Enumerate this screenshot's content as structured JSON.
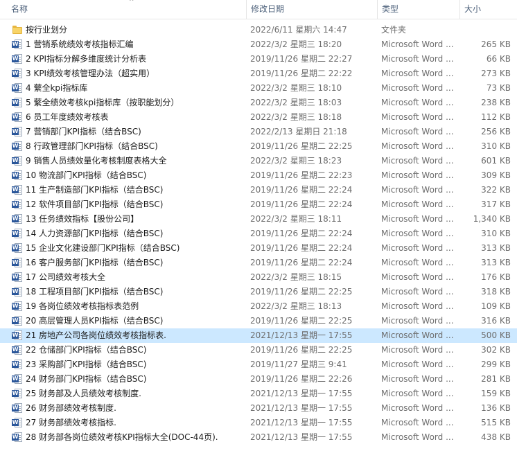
{
  "columns": {
    "name": "名称",
    "date": "修改日期",
    "type": "类型",
    "size": "大小"
  },
  "sort_indicator": "^",
  "word_badge_letter": "W",
  "rows": [
    {
      "kind": "folder",
      "name": "按行业划分",
      "date": "2022/6/11 星期六 14:47",
      "type": "文件夹",
      "size": ""
    },
    {
      "kind": "word",
      "name": "1 营销系统绩效考核指标汇编",
      "date": "2022/3/2 星期三 18:20",
      "type": "Microsoft Word ...",
      "size": "265 KB"
    },
    {
      "kind": "word",
      "name": "2 KPI指标分解多维度统计分析表",
      "date": "2019/11/26 星期二 22:27",
      "type": "Microsoft Word ...",
      "size": "66 KB"
    },
    {
      "kind": "word",
      "name": "3 KPI绩效考核管理办法（超实用）",
      "date": "2019/11/26 星期二 22:22",
      "type": "Microsoft Word ...",
      "size": "273 KB"
    },
    {
      "kind": "word",
      "name": "4 蘩全kpi指标库",
      "date": "2022/3/2 星期三 18:10",
      "type": "Microsoft Word ...",
      "size": "73 KB"
    },
    {
      "kind": "word",
      "name": "5 蘩全绩效考核kpi指标库（按职能划分）",
      "date": "2022/3/2 星期三 18:03",
      "type": "Microsoft Word ...",
      "size": "238 KB"
    },
    {
      "kind": "word",
      "name": "6 员工年度绩效考核表",
      "date": "2022/3/2 星期三 18:18",
      "type": "Microsoft Word ...",
      "size": "112 KB"
    },
    {
      "kind": "word",
      "name": "7 营销部门KPI指标（结合BSC)",
      "date": "2022/2/13 星期日 21:18",
      "type": "Microsoft Word ...",
      "size": "256 KB"
    },
    {
      "kind": "word",
      "name": "8 行政管理部门KPI指标（结合BSC)",
      "date": "2019/11/26 星期二 22:25",
      "type": "Microsoft Word ...",
      "size": "310 KB"
    },
    {
      "kind": "word",
      "name": "9 销售人员绩效量化考核制度表格大全",
      "date": "2022/3/2 星期三 18:23",
      "type": "Microsoft Word ...",
      "size": "601 KB"
    },
    {
      "kind": "word",
      "name": "10 物流部门KPI指标（结合BSC)",
      "date": "2019/11/26 星期二 22:23",
      "type": "Microsoft Word ...",
      "size": "309 KB"
    },
    {
      "kind": "word",
      "name": "11 生产制造部门KPI指标（结合BSC)",
      "date": "2019/11/26 星期二 22:24",
      "type": "Microsoft Word ...",
      "size": "322 KB"
    },
    {
      "kind": "word",
      "name": "12 软件项目部门KPI指标（结合BSC)",
      "date": "2019/11/26 星期二 22:24",
      "type": "Microsoft Word ...",
      "size": "317 KB"
    },
    {
      "kind": "word",
      "name": "13 任务绩效指标【股份公司】",
      "date": "2022/3/2 星期三 18:11",
      "type": "Microsoft Word ...",
      "size": "1,340 KB"
    },
    {
      "kind": "word",
      "name": "14 人力资源部门KPI指标（结合BSC)",
      "date": "2019/11/26 星期二 22:24",
      "type": "Microsoft Word ...",
      "size": "310 KB"
    },
    {
      "kind": "word",
      "name": "15 企业文化建设部门KPI指标（结合BSC)",
      "date": "2019/11/26 星期二 22:24",
      "type": "Microsoft Word ...",
      "size": "313 KB"
    },
    {
      "kind": "word",
      "name": "16 客户服务部门KPI指标（结合BSC)",
      "date": "2019/11/26 星期二 22:24",
      "type": "Microsoft Word ...",
      "size": "313 KB"
    },
    {
      "kind": "word",
      "name": "17 公司绩效考核大全",
      "date": "2022/3/2 星期三 18:15",
      "type": "Microsoft Word ...",
      "size": "176 KB"
    },
    {
      "kind": "word",
      "name": "18 工程项目部门KPI指标（结合BSC)",
      "date": "2019/11/26 星期二 22:25",
      "type": "Microsoft Word ...",
      "size": "318 KB"
    },
    {
      "kind": "word",
      "name": "19 各岗位绩效考核指标表范例",
      "date": "2022/3/2 星期三 18:13",
      "type": "Microsoft Word ...",
      "size": "109 KB"
    },
    {
      "kind": "word",
      "name": "20 高层管理人员KPI指标（结合BSC)",
      "date": "2019/11/26 星期二 22:25",
      "type": "Microsoft Word ...",
      "size": "316 KB"
    },
    {
      "kind": "word",
      "name": "21 房地产公司各岗位绩效考核指标表.",
      "date": "2021/12/13 星期一 17:55",
      "type": "Microsoft Word ...",
      "size": "500 KB",
      "selected": true
    },
    {
      "kind": "word",
      "name": "22 仓储部门KPI指标（结合BSC)",
      "date": "2019/11/26 星期二 22:25",
      "type": "Microsoft Word ...",
      "size": "302 KB"
    },
    {
      "kind": "word",
      "name": "23 采购部门KPI指标（结合BSC)",
      "date": "2019/11/27 星期三 9:41",
      "type": "Microsoft Word ...",
      "size": "299 KB"
    },
    {
      "kind": "word",
      "name": "24 财务部门KPI指标（结合BSC)",
      "date": "2019/11/26 星期二 22:26",
      "type": "Microsoft Word ...",
      "size": "281 KB"
    },
    {
      "kind": "word",
      "name": "25 财务部及人员绩效考核制度.",
      "date": "2021/12/13 星期一 17:55",
      "type": "Microsoft Word ...",
      "size": "159 KB"
    },
    {
      "kind": "word",
      "name": "26 财务部绩效考核制度.",
      "date": "2021/12/13 星期一 17:55",
      "type": "Microsoft Word ...",
      "size": "136 KB"
    },
    {
      "kind": "word",
      "name": "27 财务部绩效考核指标.",
      "date": "2021/12/13 星期一 17:55",
      "type": "Microsoft Word ...",
      "size": "515 KB"
    },
    {
      "kind": "word",
      "name": "28 财务部各岗位绩效考核KPI指标大全(DOC-44页).",
      "date": "2021/12/13 星期一 17:55",
      "type": "Microsoft Word ...",
      "size": "438 KB"
    }
  ],
  "colors": {
    "selected_row": "#cce8ff",
    "header_text": "#4c607a",
    "word_blue": "#2b579a",
    "folder_yellow": "#f8d468"
  }
}
